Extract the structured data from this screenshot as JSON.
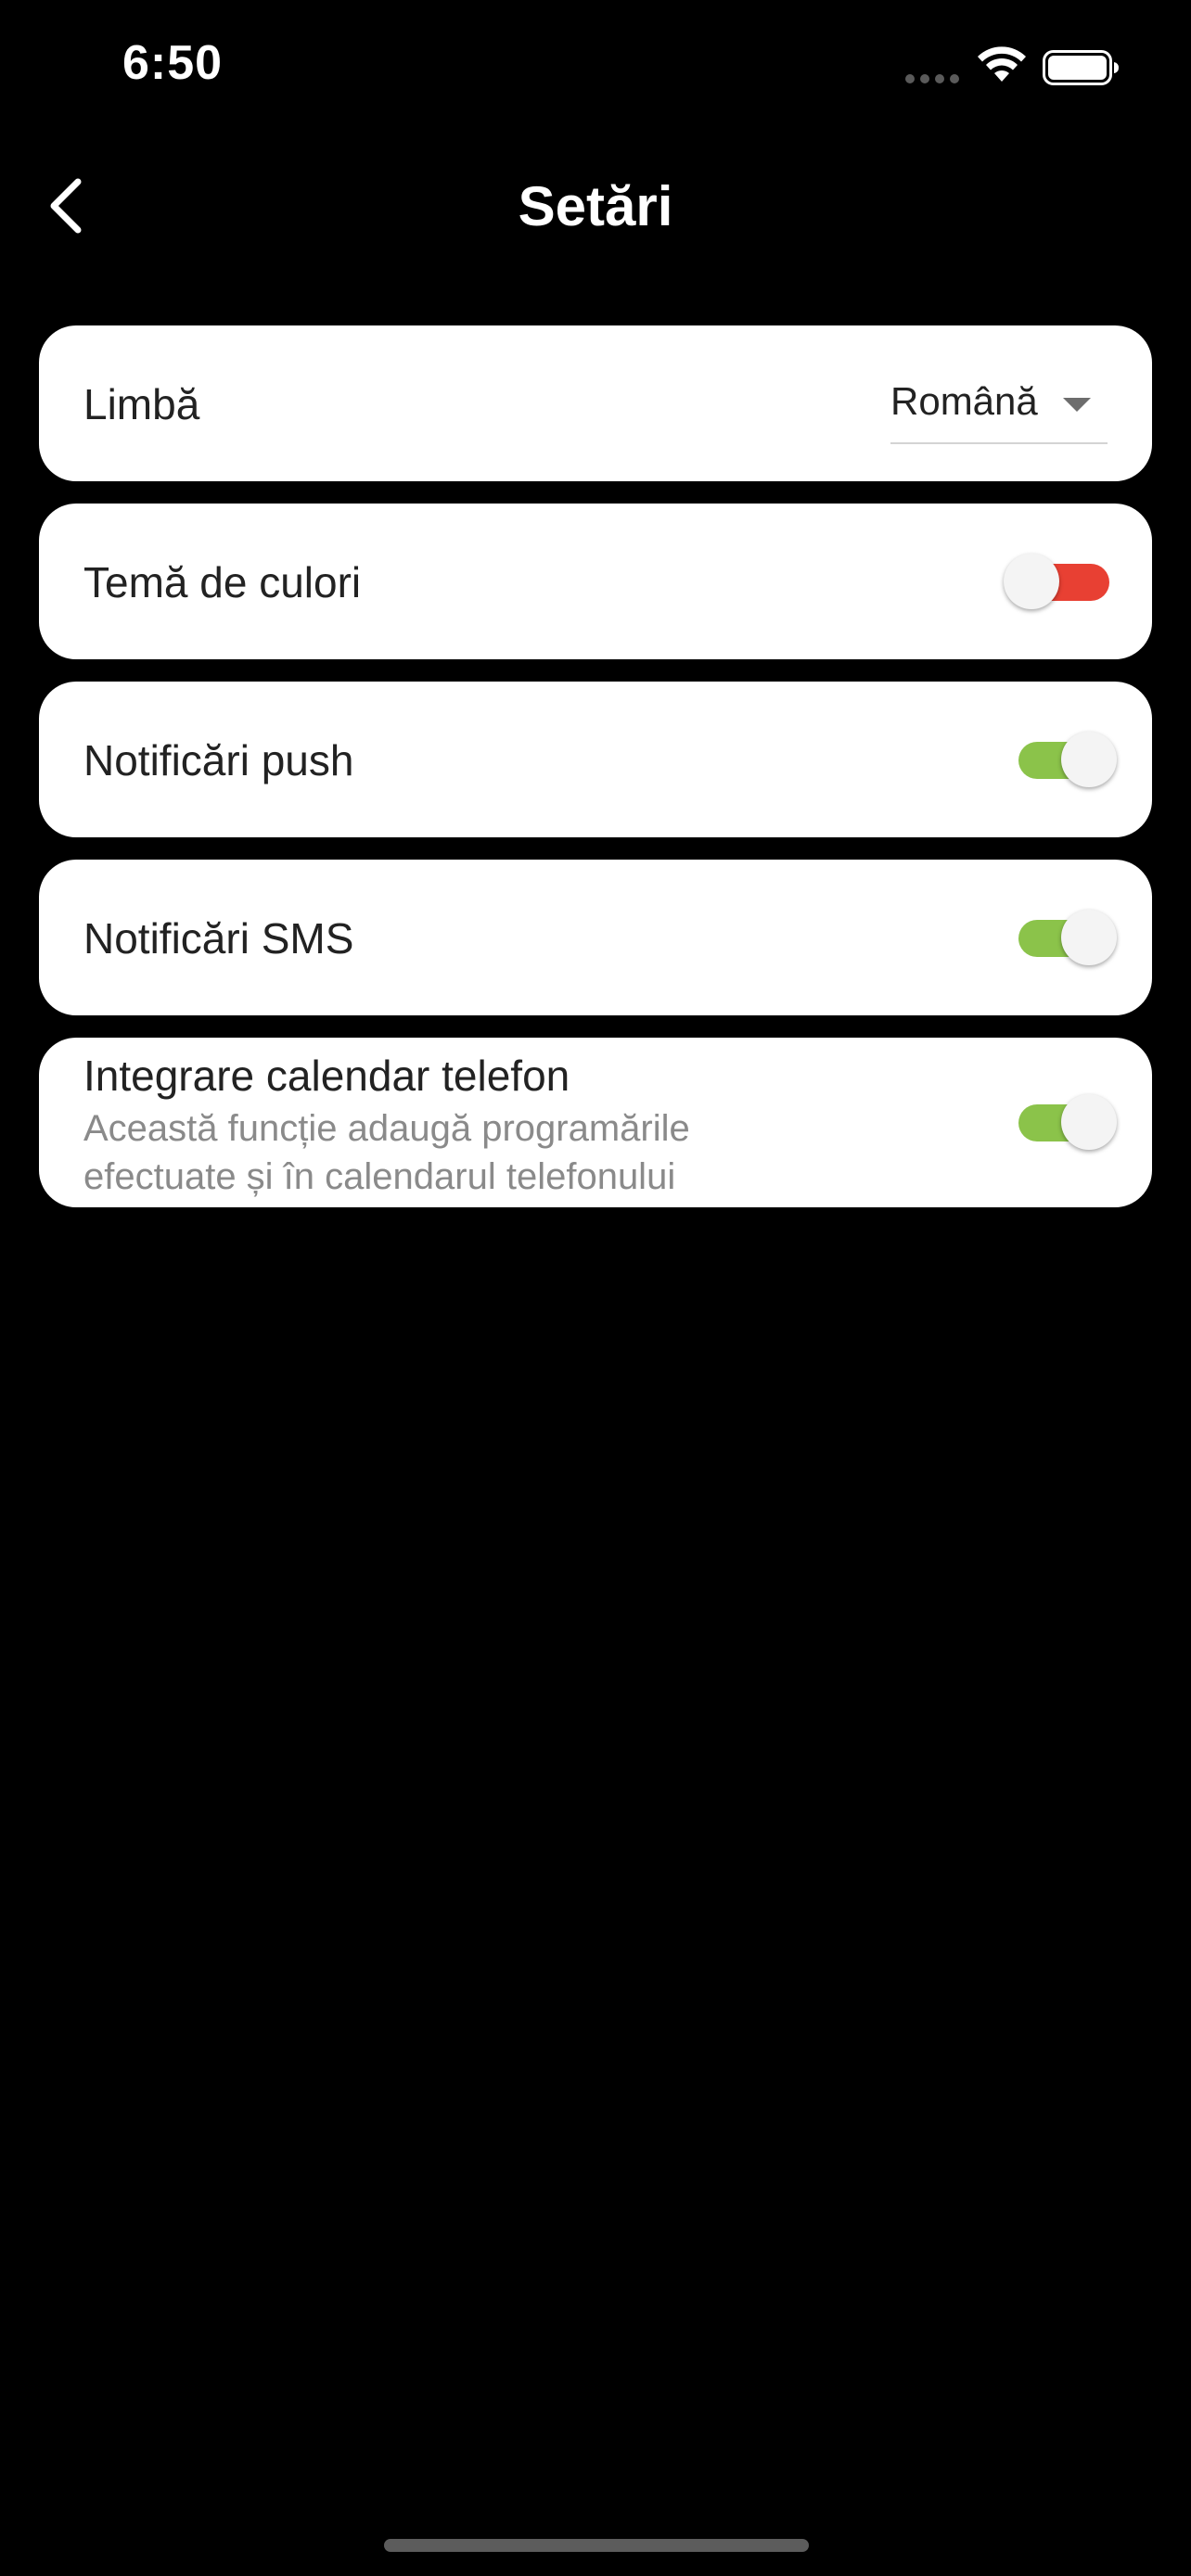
{
  "status_bar": {
    "time": "6:50",
    "icons": [
      "cellular-signal-icon",
      "wifi-icon",
      "battery-icon"
    ]
  },
  "header": {
    "back_icon": "chevron-left-icon",
    "title": "Setări"
  },
  "settings": {
    "language": {
      "label": "Limbă",
      "selected": "Română"
    },
    "color_theme": {
      "label": "Temă de culori",
      "enabled": false,
      "track_color": "#e84033"
    },
    "push_notifications": {
      "label": "Notificări push",
      "enabled": true,
      "track_color": "#8bc34a"
    },
    "sms_notifications": {
      "label": "Notificări SMS",
      "enabled": true,
      "track_color": "#8bc34a"
    },
    "calendar_integration": {
      "label": "Integrare calendar telefon",
      "description_line1": "Această funcție adaugă programările",
      "description_line2": "efectuate și în calendarul telefonului",
      "enabled": true,
      "track_color": "#8bc34a"
    }
  },
  "colors": {
    "background": "#000000",
    "card": "#ffffff",
    "toggle_on": "#8bc34a",
    "toggle_off_accent": "#e84033"
  }
}
